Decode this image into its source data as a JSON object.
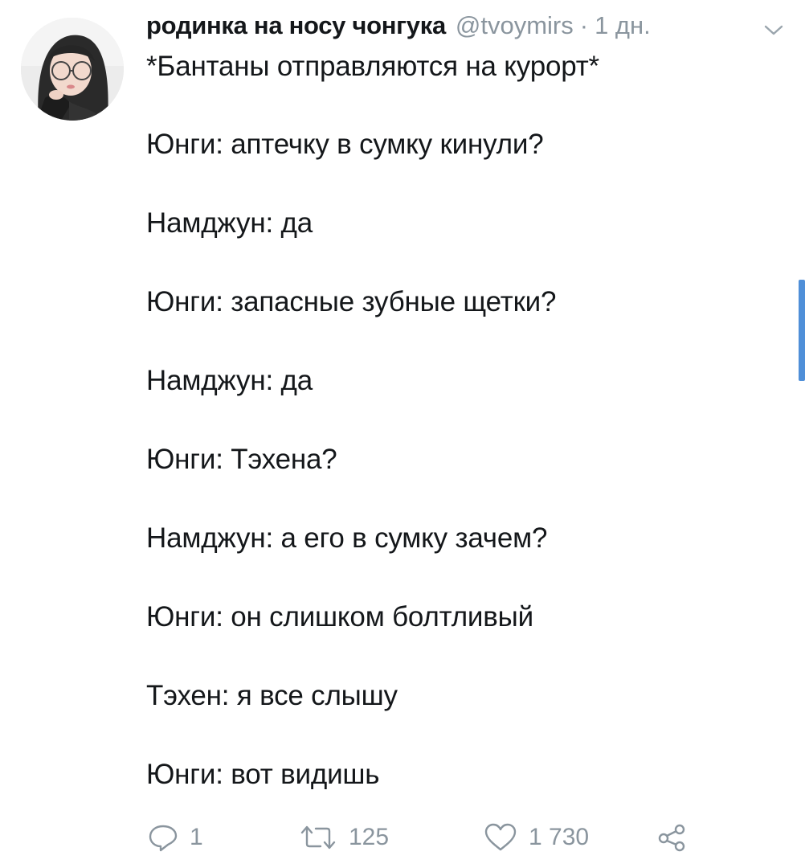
{
  "tweet": {
    "display_name": "родинка на носу чонгука",
    "handle": "@tvoymirs",
    "separator": "·",
    "time": "1 дн.",
    "lines": [
      "*Бантаны отправляются на курорт*",
      "Юнги: аптечку в сумку кинули?",
      "Намджун: да",
      "Юнги: запасные зубные щетки?",
      "Намджун: да",
      "Юнги: Тэхена?",
      "Намджун: а его в сумку зачем?",
      "Юнги: он слишком болтливый",
      "Тэхен: я все слышу",
      "Юнги: вот видишь"
    ],
    "actions": {
      "reply_count": "1",
      "retweet_count": "125",
      "like_count": "1 730"
    }
  },
  "icons": {
    "reply": "reply-icon",
    "retweet": "retweet-icon",
    "like": "heart-icon",
    "share": "share-icon",
    "menu": "chevron-down-icon"
  },
  "colors": {
    "text": "#14171a",
    "secondary": "#8a959e",
    "scrollbar": "#4f8fd8"
  }
}
